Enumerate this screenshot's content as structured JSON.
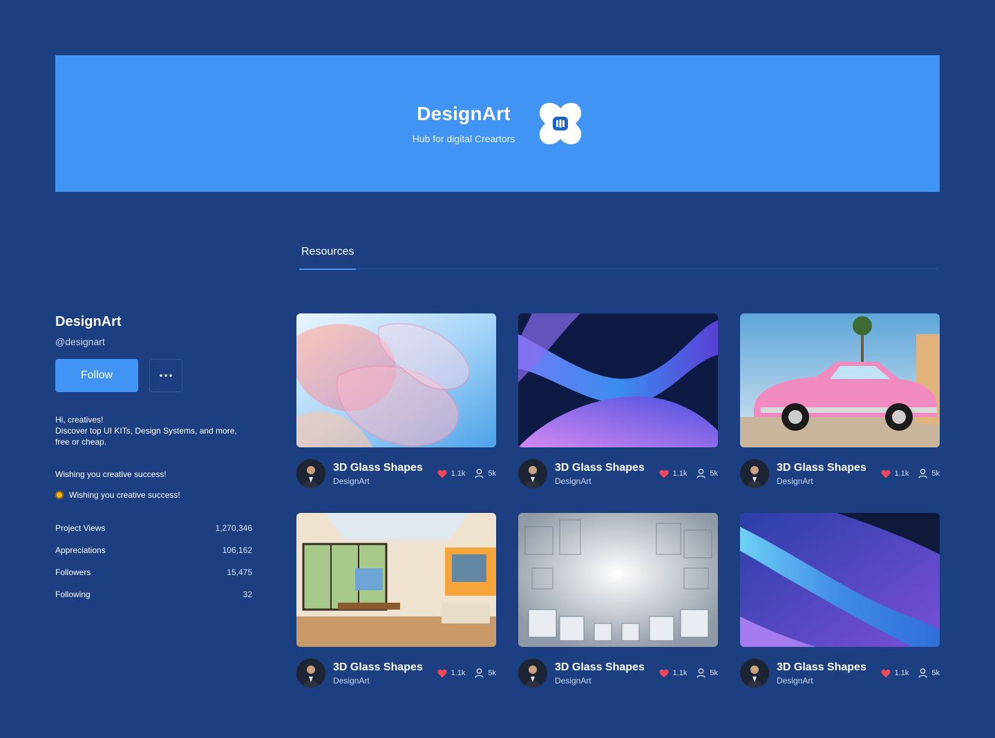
{
  "banner": {
    "title": "DesignArt",
    "subtitle": "Hub for digital Creartors",
    "logo_icon": "designart-logo-icon"
  },
  "tabs": [
    {
      "label": "Resources",
      "active": true
    }
  ],
  "profile": {
    "name": "DesignArt",
    "handle": "@designart",
    "follow_label": "Follow",
    "more_label": "•••",
    "bio": [
      "Hi, creatives!",
      "Discover top UI KITs, Design Systems, and more,",
      "free or cheap."
    ],
    "wish": "Wishing you creative success!",
    "wish_with_icon": "Wishing you creative success!",
    "stats": [
      {
        "label": "Project Views",
        "value": "1,270,346"
      },
      {
        "label": "Appreciations",
        "value": "106,162"
      },
      {
        "label": "Followers",
        "value": "15,475"
      },
      {
        "label": "Following",
        "value": "32"
      }
    ]
  },
  "cards": [
    {
      "title": "3D Glass Shapes",
      "author": "DesignArt",
      "likes": "1.1k",
      "views": "5k",
      "image": "glass-shapes-pink"
    },
    {
      "title": "3D Glass Shapes",
      "author": "DesignArt",
      "likes": "1.1k",
      "views": "5k",
      "image": "blue-purple-waves"
    },
    {
      "title": "3D Glass Shapes",
      "author": "DesignArt",
      "likes": "1.1k",
      "views": "5k",
      "image": "pink-vintage-car"
    },
    {
      "title": "3D Glass Shapes",
      "author": "DesignArt",
      "likes": "1.1k",
      "views": "5k",
      "image": "art-studio-room"
    },
    {
      "title": "3D Glass Shapes",
      "author": "DesignArt",
      "likes": "1.1k",
      "views": "5k",
      "image": "white-cube-city"
    },
    {
      "title": "3D Glass Shapes",
      "author": "DesignArt",
      "likes": "1.1k",
      "views": "5k",
      "image": "blue-glass-ribbon"
    }
  ],
  "colors": {
    "background": "#1b3f80",
    "accent": "#4193f4",
    "heart": "#f0475a"
  }
}
